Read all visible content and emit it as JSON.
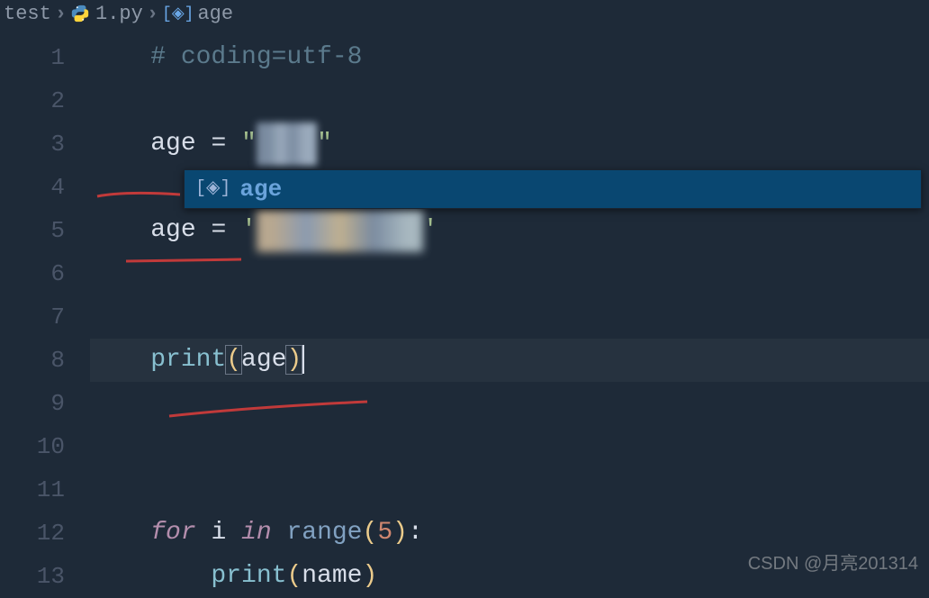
{
  "breadcrumb": {
    "folder": "test",
    "file": "1.py",
    "symbol": "age"
  },
  "lines": {
    "l1": "# coding=utf-8",
    "l3_var": "age",
    "l3_eq": " = ",
    "l3_q1": "\"",
    "l3_str": "XXXX",
    "l3_q2": "\"",
    "l5_var": "age",
    "l5_eq": " = ",
    "l5_q1": "'",
    "l5_str": "lXXXXXXXXXu",
    "l5_q2": "'",
    "l8_fn": "print",
    "l8_p1": "(",
    "l8_arg": "age",
    "l8_p2": ")",
    "l12_for": "for",
    "l12_var": " i ",
    "l12_in": "in",
    "l12_range": " range",
    "l12_p1": "(",
    "l12_num": "5",
    "l12_p2": ")",
    "l12_colon": ":",
    "l13_fn": "print",
    "l13_p1": "(",
    "l13_arg": "name",
    "l13_p2": ")"
  },
  "line_numbers": [
    "1",
    "2",
    "3",
    "4",
    "5",
    "6",
    "7",
    "8",
    "9",
    "10",
    "11",
    "12",
    "13"
  ],
  "autocomplete": {
    "item": "age"
  },
  "watermark": "CSDN @月亮201314"
}
